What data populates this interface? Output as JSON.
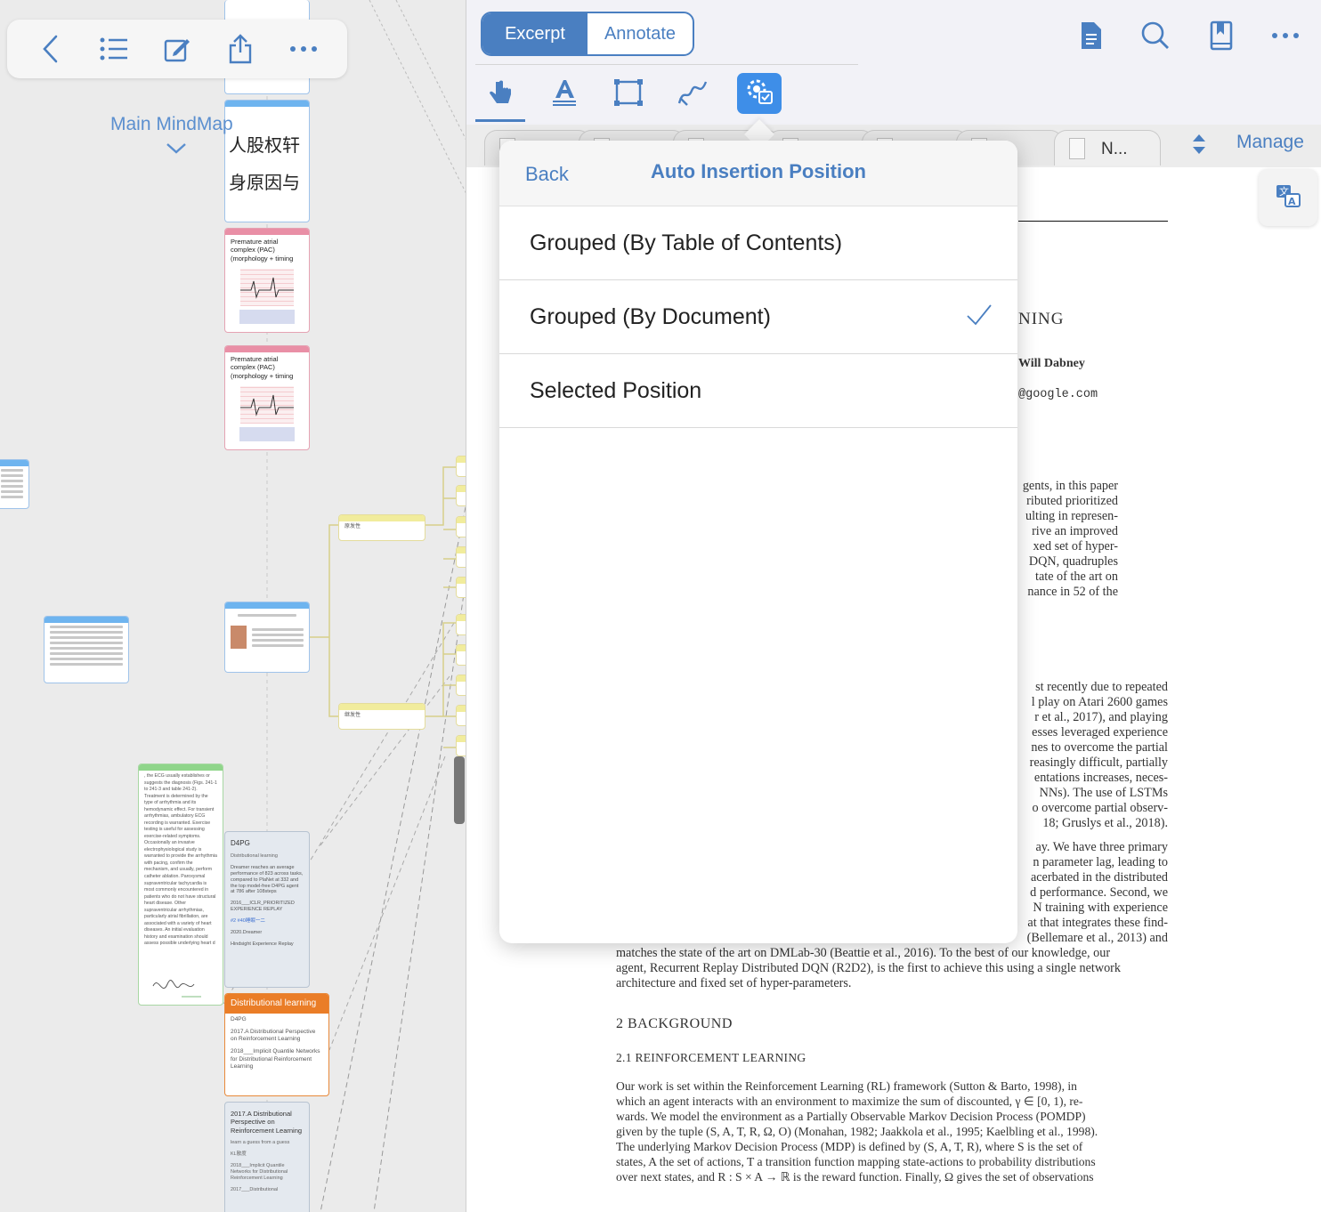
{
  "mindmap": {
    "title": "Main MindMap",
    "toolbar": {
      "icons": [
        "back-chevron-icon",
        "list-icon",
        "edit-icon",
        "share-icon",
        "more-icon"
      ]
    },
    "card_cjk_1": "人股权轩",
    "card_cjk_2": "身原因与",
    "pac_card_1": {
      "text": "Premature atrial complex (PAC) (morphology + timing"
    },
    "pac_card_2": {
      "text": "Premature atrial complex (PAC) (morphology + timing"
    },
    "yellow_node_1": "原发性",
    "yellow_node_2": "继发性",
    "green_card_text": ", the ECG usually establishes or suggests the diagnosis (Figs. 241-1 to 241-3 and table 241-2). Treatment is determined by the type of arrhythmia and its hemodynamic effect. For transient arrhythmias, ambulatory ECG recording is warranted. Exercise testing is useful for assessing exercise-related symptoms. Occasionally an invasive electrophysiological study is warranted to provide the arrhythmia with pacing, confirm the mechanism, and usually, perform catheter ablation. Paroxysmal supraventricular tachycardia is most commonly encountered in patients who do not have structural heart disease. Other supraventricular arrhythmias, particularly atrial fibrillation, are associated with a variety of heart diseases. An initial evaluation history and examination should assess possible underlying heart d",
    "d4pg_card": {
      "title": "D4PG",
      "items": [
        "Distributional learning",
        "Dreamer reaches an average performance of 823 across tasks, compared to PlaNet at 332 and the top model-free D4PG agent at 786 after 108steps",
        "2016___ICLR_PRIORITIZED EXPERIENCE REPLAY",
        "#2 #40睡眠一二",
        "2020.Dreamer",
        "Hindsight Experience Replay"
      ]
    },
    "dist_card": {
      "title": "Distributional learning",
      "items": [
        "D4PG",
        "2017.A Distributional Perspective on Reinforcement Learning",
        "2018___Implicit Quantile Networks for Distributional Reinforcement Learning"
      ]
    },
    "grey_card": {
      "items": [
        "2017.A Distributional Perspective on Reinforcement Learning",
        "learn a guess from a guess",
        "KL散度",
        "2018___Implicit Quantile Networks for Distributional Reinforcement Learning",
        "2017___Distributional"
      ]
    }
  },
  "reader": {
    "segments": [
      "Excerpt",
      "Annotate"
    ],
    "active_segment": "Excerpt",
    "top_icons": [
      "document-icon",
      "search-icon",
      "bookmark-icon",
      "more-icon"
    ],
    "tools": [
      "hand-pointer-icon",
      "highlight-text-icon",
      "rectangle-select-icon",
      "draw-icon",
      "gear-settings-icon"
    ],
    "tabs": [
      {
        "label": ""
      },
      {
        "label": ""
      },
      {
        "label": ""
      },
      {
        "label": ""
      },
      {
        "label": ""
      },
      {
        "label": ""
      },
      {
        "label": "N..."
      }
    ],
    "manage_label": "Manage",
    "paper": {
      "title_frag": "NING",
      "author_frag": "Will Dabney",
      "email_frag": "@google.com",
      "abstract_lines": [
        "gents, in this paper",
        "ributed prioritized",
        "ulting in represen-",
        "rive an improved",
        "xed set of hyper-",
        "DQN, quadruples",
        "tate of the art on",
        "nance in 52 of the"
      ],
      "intro_lines": [
        "st recently due to repeated",
        "l play on Atari 2600 games",
        "r et al., 2017), and playing",
        "esses leveraged experience",
        "nes to overcome the partial",
        "reasingly difficult, partially",
        "entations increases, neces-",
        "NNs). The use of LSTMs",
        "o overcome partial observ-",
        "18; Gruslys et al., 2018)."
      ],
      "para2_lines": [
        "ay. We have three primary",
        "n parameter lag, leading to",
        "acerbated in the distributed",
        "d performance. Second, we",
        "N training with experience",
        "at that integrates these find-",
        "(Bellemare et al., 2013) and"
      ],
      "para2_full": [
        "matches the state of the art on DMLab-30 (Beattie et al., 2016). To the best of our knowledge, our",
        "agent, Recurrent Replay Distributed DQN (R2D2), is the first to achieve this using a single network",
        "architecture and fixed set of hyper-parameters."
      ],
      "section2": "2   BACKGROUND",
      "section21": "2.1   REINFORCEMENT LEARNING",
      "rl_lines": [
        "Our work is set within the Reinforcement Learning (RL) framework (Sutton & Barto, 1998), in",
        "which an agent interacts with an environment to maximize the sum of discounted, γ ∈ [0, 1), re-",
        "wards. We model the environment as a Partially Observable Markov Decision Process (POMDP)",
        "given by the tuple (S, A, T, R, Ω, O) (Monahan, 1982; Jaakkola et al., 1995; Kaelbling et al., 1998).",
        "The underlying Markov Decision Process (MDP) is defined by (S, A, T, R), where S is the set of",
        "states, A the set of actions, T a transition function mapping state-actions to probability distributions",
        "over next states, and R : S × A → ℝ is the reward function. Finally, Ω gives the set of observations"
      ]
    }
  },
  "popover": {
    "back_label": "Back",
    "title": "Auto Insertion Position",
    "options": [
      {
        "label": "Grouped (By Table of Contents)",
        "selected": false
      },
      {
        "label": "Grouped (By Document)",
        "selected": true
      },
      {
        "label": "Selected Position",
        "selected": false
      }
    ]
  },
  "colors": {
    "accent": "#4a7fc1",
    "settings_button": "#3e8ee8",
    "orange_node": "#ea7d27"
  }
}
